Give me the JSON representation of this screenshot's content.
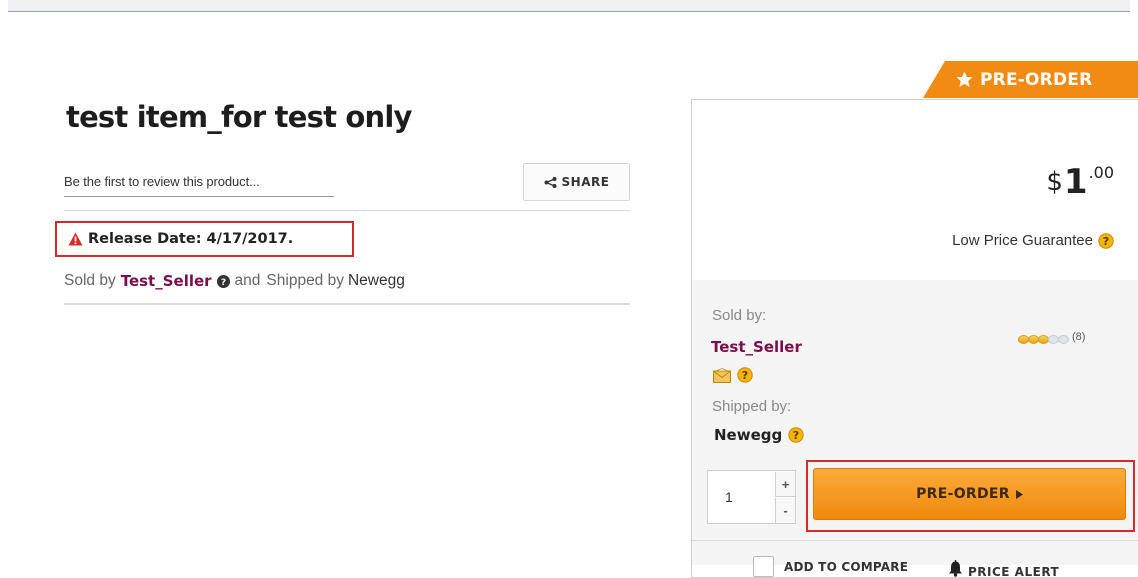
{
  "product": {
    "title": "test item_for test only",
    "review_link": "Be the first to review this product...",
    "share_label": "SHARE",
    "release_date": "Release Date: 4/17/2017.",
    "sold_by_prefix": "Sold by",
    "seller_name": "Test_Seller",
    "and_text": "and",
    "shipped_by_prefix": "Shipped by",
    "shipper_name": "Newegg"
  },
  "buy_box": {
    "badge_label": "PRE-ORDER",
    "price": {
      "currency": "$",
      "dollars": "1",
      "cents": ".00"
    },
    "low_price_guarantee": "Low Price Guarantee",
    "sold_by_label": "Sold by:",
    "seller_name": "Test_Seller",
    "rating": {
      "eggs_filled": 3,
      "eggs_total": 5,
      "count_text": "(8)"
    },
    "shipped_by_label": "Shipped by:",
    "shipper_name": "Newegg",
    "quantity": "1",
    "qty_increment": "+",
    "qty_decrement": "-",
    "preorder_button_label": "PRE-ORDER",
    "add_to_compare_label": "ADD TO COMPARE",
    "price_alert_label": "PRICE ALERT"
  },
  "colors": {
    "accent_orange": "#f28b13",
    "seller_link": "#7a0e4a",
    "highlight_red": "#d62b2b"
  }
}
